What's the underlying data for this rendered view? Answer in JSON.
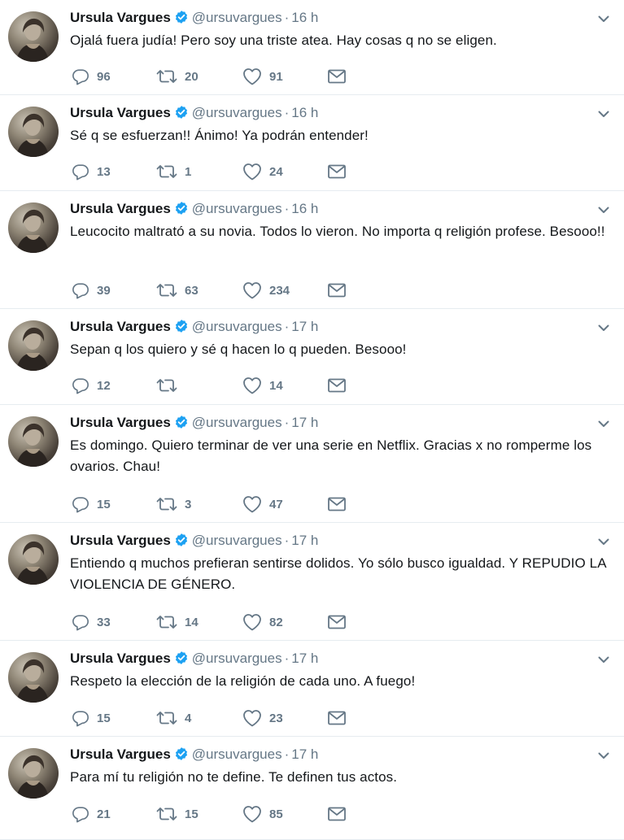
{
  "user": {
    "name": "Ursula Vargues",
    "handle": "@ursuvargues",
    "verified": true,
    "avatar_icon": "profile-photo"
  },
  "icons": {
    "verified": "verified-badge-icon",
    "caret": "chevron-down-icon",
    "reply": "reply-icon",
    "retweet": "retweet-icon",
    "like": "heart-icon",
    "dm": "envelope-icon"
  },
  "colors": {
    "verified_badge": "#1da1f2",
    "muted": "#657786",
    "text": "#14171a",
    "divider": "#e6ecf0"
  },
  "tweets": [
    {
      "time": "16 h",
      "text": "Ojalá fuera judía! Pero soy una triste atea. Hay cosas q no se eligen.",
      "replies": "96",
      "retweets": "20",
      "likes": "91"
    },
    {
      "time": "16 h",
      "text": "Sé q se esfuerzan!! Ánimo! Ya podrán entender!",
      "replies": "13",
      "retweets": "1",
      "likes": "24"
    },
    {
      "time": "16 h",
      "text": "Leucocito maltrató a su novia. Todos lo vieron. No importa q religión profese. Besooo!!",
      "replies": "39",
      "retweets": "63",
      "likes": "234"
    },
    {
      "time": "17 h",
      "text": "Sepan q los quiero y sé q hacen lo q pueden. Besooo!",
      "replies": "12",
      "retweets": "",
      "likes": "14"
    },
    {
      "time": "17 h",
      "text": "Es domingo. Quiero terminar de ver una serie en Netflix. Gracias x no romperme los ovarios. Chau!",
      "replies": "15",
      "retweets": "3",
      "likes": "47"
    },
    {
      "time": "17 h",
      "text": "Entiendo q muchos prefieran sentirse dolidos. Yo sólo busco igualdad. Y REPUDIO LA VIOLENCIA DE GÉNERO.",
      "replies": "33",
      "retweets": "14",
      "likes": "82"
    },
    {
      "time": "17 h",
      "text": "Respeto la elección de la religión de cada uno. A fuego!",
      "replies": "15",
      "retweets": "4",
      "likes": "23"
    },
    {
      "time": "17 h",
      "text": "Para mí tu religión no te define. Te definen tus actos.",
      "replies": "21",
      "retweets": "15",
      "likes": "85"
    }
  ]
}
